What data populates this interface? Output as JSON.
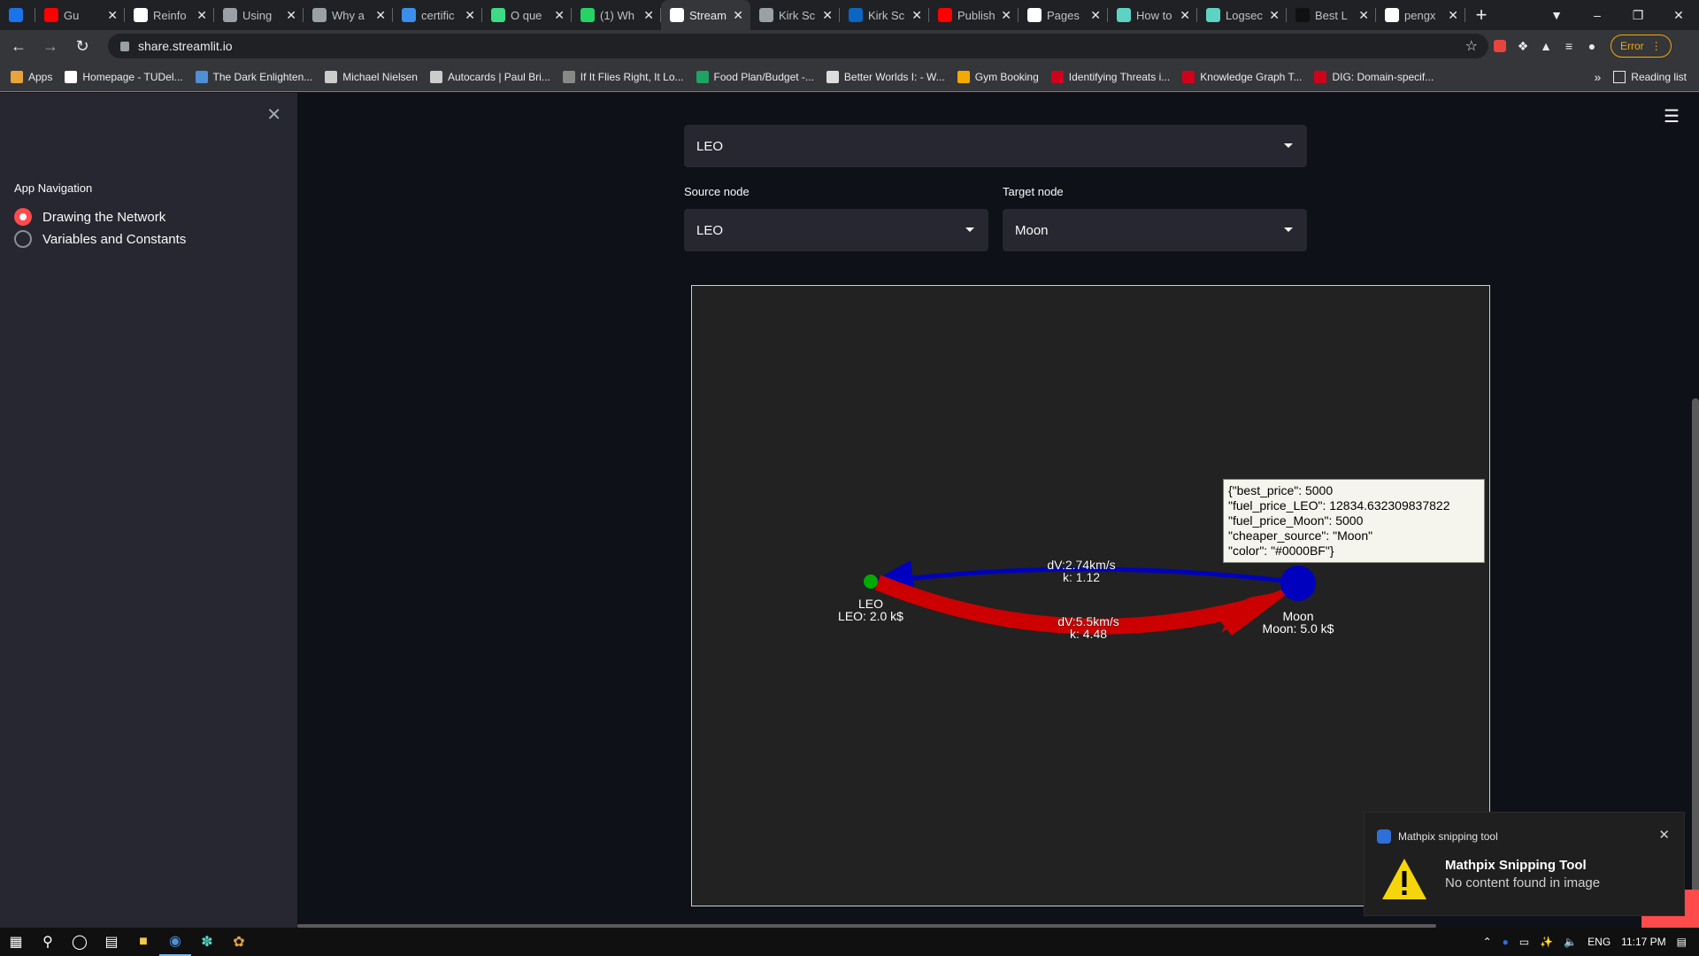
{
  "browser": {
    "tabs": [
      {
        "label": "",
        "color": "#1a73e8",
        "icon": "gem-icon"
      },
      {
        "label": "Gu",
        "color": "#ff0000",
        "icon": "youtube-icon",
        "audio": true
      },
      {
        "label": "Reinfo",
        "color": "#ffffff",
        "icon": "medium-icon"
      },
      {
        "label": "Using",
        "color": "#9aa0a6",
        "icon": "globe-icon"
      },
      {
        "label": "Why a",
        "color": "#9aa0a6",
        "icon": "globe-icon"
      },
      {
        "label": "certific",
        "color": "#3b8eea",
        "icon": "wave-icon"
      },
      {
        "label": "O que",
        "color": "#3ddc84",
        "icon": "leaf-icon"
      },
      {
        "label": "(1) Wh",
        "color": "#25d366",
        "icon": "whatsapp-icon"
      },
      {
        "label": "Stream",
        "color": "#ffffff",
        "icon": "streamlit-icon",
        "active": true
      },
      {
        "label": "Kirk Sc",
        "color": "#9aa0a6",
        "icon": "globe-icon"
      },
      {
        "label": "Kirk Sc",
        "color": "#0a66c2",
        "icon": "linkedin-icon"
      },
      {
        "label": "Publish",
        "color": "#ff0000",
        "icon": "youtube-icon"
      },
      {
        "label": "Pages",
        "color": "#ffffff",
        "icon": "github-icon"
      },
      {
        "label": "How to",
        "color": "#5dd3c4",
        "icon": "logseq-icon"
      },
      {
        "label": "Logsec",
        "color": "#5dd3c4",
        "icon": "logseq-icon"
      },
      {
        "label": "Best L",
        "color": "#111111",
        "icon": "circle-icon"
      },
      {
        "label": "pengx",
        "color": "#ffffff",
        "icon": "github-icon"
      }
    ],
    "url": "share.streamlit.io",
    "error_label": "Error",
    "bookmarks": [
      {
        "label": "Apps",
        "color": "#e8a33d"
      },
      {
        "label": "Homepage - TUDel...",
        "color": "#ffffff"
      },
      {
        "label": "The Dark Enlighten...",
        "color": "#4f8fd6"
      },
      {
        "label": "Michael Nielsen",
        "color": "#cccccc"
      },
      {
        "label": "Autocards | Paul Bri...",
        "color": "#cccccc"
      },
      {
        "label": "If It Flies Right, It Lo...",
        "color": "#888888"
      },
      {
        "label": "Food Plan/Budget -...",
        "color": "#1ea362"
      },
      {
        "label": "Better Worlds I: - W...",
        "color": "#dddddd"
      },
      {
        "label": "Gym Booking",
        "color": "#f2a900"
      },
      {
        "label": "Identifying Threats i...",
        "color": "#d0021b"
      },
      {
        "label": "Knowledge Graph T...",
        "color": "#d0021b"
      },
      {
        "label": "DIG: Domain-specif...",
        "color": "#d0021b"
      }
    ],
    "more": "»",
    "reading_list": "Reading list"
  },
  "sidebar": {
    "title": "App Navigation",
    "options": [
      {
        "label": "Drawing the Network",
        "selected": true
      },
      {
        "label": "Variables and Constants",
        "selected": false
      }
    ]
  },
  "main": {
    "top_select_value": "LEO",
    "source_label": "Source node",
    "source_value": "LEO",
    "target_label": "Target node",
    "target_value": "Moon"
  },
  "graph": {
    "nodes": [
      {
        "id": "LEO",
        "label": "LEO",
        "sublabel": "LEO: 2.0 k$",
        "color": "#00aa00"
      },
      {
        "id": "Moon",
        "label": "Moon",
        "sublabel": "Moon: 5.0 k$",
        "color": "#0000BF"
      }
    ],
    "edges": [
      {
        "from": "Moon",
        "to": "LEO",
        "label1": "dV:2.74km/s",
        "label2": "k: 1.12",
        "color": "#0000BF"
      },
      {
        "from": "LEO",
        "to": "Moon",
        "label1": "dV:5.5km/s",
        "label2": "k: 4.48",
        "color": "#cc0000"
      }
    ],
    "tooltip": "{\"best_price\": 5000\n\"fuel_price_LEO\": 12834.632309837822\n\"fuel_price_Moon\": 5000\n\"cheaper_source\": \"Moon\"\n\"color\": \"#0000BF\"}"
  },
  "notification": {
    "app": "Mathpix snipping tool",
    "title": "Mathpix Snipping Tool",
    "body": "No content found in image"
  },
  "taskbar": {
    "lang": "ENG",
    "time": "11:17 PM"
  }
}
